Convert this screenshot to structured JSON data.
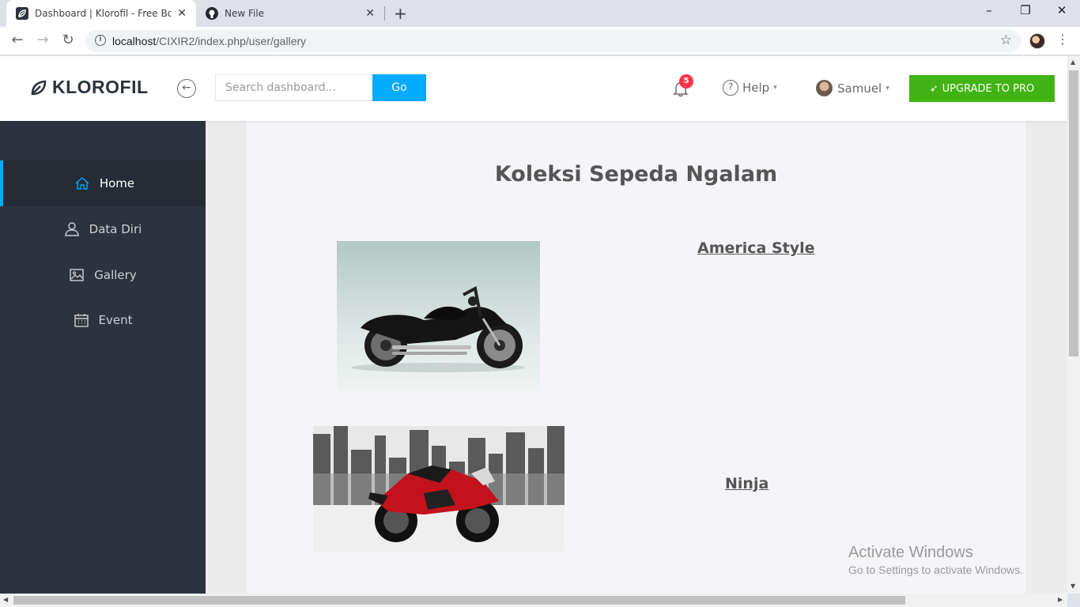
{
  "browser": {
    "tabs": [
      {
        "title": "Dashboard | Klorofil - Free Bootstrap",
        "active": true,
        "favicon": "klorofil-leaf-icon"
      },
      {
        "title": "New File",
        "active": false,
        "favicon": "github-icon"
      }
    ],
    "url_host": "localhost",
    "url_path": "/CIXIR2/index.php/user/gallery",
    "window_controls": {
      "minimize": "–",
      "restore": "❐",
      "close": "✕"
    }
  },
  "header": {
    "brand": "KLOROFIL",
    "search_placeholder": "Search dashboard...",
    "go_label": "Go",
    "notification_count": "5",
    "help_label": "Help",
    "user_name": "Samuel",
    "upgrade_label": "UPGRADE TO PRO"
  },
  "sidebar": {
    "items": [
      {
        "label": "Home",
        "icon": "home-icon",
        "active": true
      },
      {
        "label": "Data Diri",
        "icon": "user-icon",
        "active": false
      },
      {
        "label": "Gallery",
        "icon": "picture-icon",
        "active": false
      },
      {
        "label": "Event",
        "icon": "calendar-icon",
        "active": false
      }
    ]
  },
  "main": {
    "title": "Koleksi Sepeda Ngalam",
    "gallery": [
      {
        "label": "America Style",
        "image": "cruiser-motorcycle-photo"
      },
      {
        "label": "Ninja",
        "image": "sport-motorcycle-photo"
      }
    ]
  },
  "watermark": {
    "line1": "Activate Windows",
    "line2": "Go to Settings to activate Windows."
  },
  "colors": {
    "sidebar_bg": "#2b333e",
    "accent_blue": "#00aaff",
    "upgrade_green": "#41b314",
    "badge_red": "#f9354c"
  }
}
